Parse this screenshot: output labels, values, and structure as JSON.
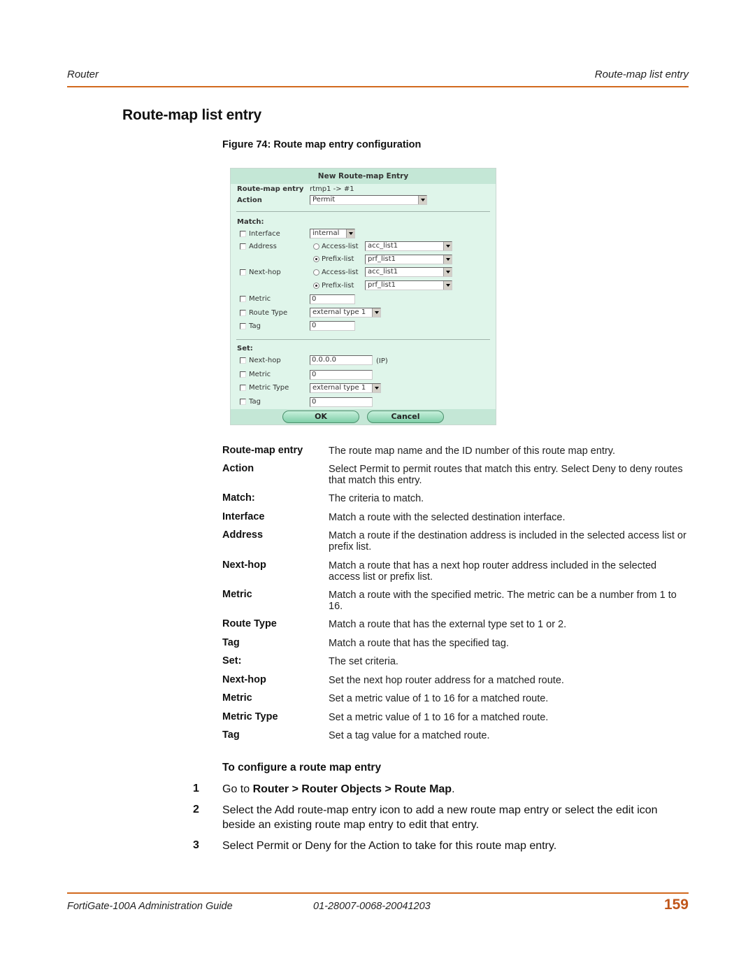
{
  "header": {
    "left": "Router",
    "right": "Route-map list entry"
  },
  "title": "Route-map list entry",
  "figure_caption": "Figure 74: Route map entry configuration",
  "form": {
    "title": "New Route-map Entry",
    "route_map_entry_label": "Route-map entry",
    "route_map_entry_value": "rtmp1 -> #1",
    "action_label": "Action",
    "action_value": "Permit",
    "match_heading": "Match:",
    "match": {
      "interface": {
        "label": "Interface",
        "value": "internal",
        "checked": false
      },
      "address": {
        "label": "Address",
        "checked": false,
        "access_list_label": "Access-list",
        "access_list_value": "acc_list1",
        "access_selected": false,
        "prefix_list_label": "Prefix-list",
        "prefix_list_value": "prf_list1",
        "prefix_selected": true
      },
      "next_hop": {
        "label": "Next-hop",
        "checked": false,
        "access_list_label": "Access-list",
        "access_list_value": "acc_list1",
        "access_selected": false,
        "prefix_list_label": "Prefix-list",
        "prefix_list_value": "prf_list1",
        "prefix_selected": true
      },
      "metric": {
        "label": "Metric",
        "value": "0",
        "checked": false
      },
      "route_type": {
        "label": "Route Type",
        "value": "external type 1",
        "checked": false
      },
      "tag": {
        "label": "Tag",
        "value": "0",
        "checked": false
      }
    },
    "set_heading": "Set:",
    "set": {
      "next_hop": {
        "label": "Next-hop",
        "value": "0.0.0.0",
        "suffix": "(IP)",
        "checked": false
      },
      "metric": {
        "label": "Metric",
        "value": "0",
        "checked": false
      },
      "metric_type": {
        "label": "Metric Type",
        "value": "external type 1",
        "checked": false
      },
      "tag": {
        "label": "Tag",
        "value": "0",
        "checked": false
      }
    },
    "ok_label": "OK",
    "cancel_label": "Cancel"
  },
  "definitions": [
    {
      "term": "Route-map entry",
      "desc": "The route map name and the ID number of this route map entry."
    },
    {
      "term": "Action",
      "desc": "Select Permit to permit routes that match this entry. Select Deny to deny routes that match this entry."
    },
    {
      "term": "Match:",
      "desc": "The criteria to match."
    },
    {
      "term": "Interface",
      "desc": "Match a route with the selected destination interface."
    },
    {
      "term": "Address",
      "desc": "Match a route if the destination address is included in the selected access list or prefix list."
    },
    {
      "term": "Next-hop",
      "desc": "Match a route that has a next hop router address included in the selected access list or prefix list."
    },
    {
      "term": "Metric",
      "desc": "Match a route with the specified metric. The metric can be a number from 1 to 16."
    },
    {
      "term": "Route Type",
      "desc": "Match a route that has the external type set to 1 or 2."
    },
    {
      "term": "Tag",
      "desc": "Match a route that has the specified tag."
    },
    {
      "term": "Set:",
      "desc": "The set criteria."
    },
    {
      "term": "Next-hop",
      "desc": "Set the next hop router address for a matched route."
    },
    {
      "term": "Metric",
      "desc": "Set a metric value of 1 to 16 for a matched route."
    },
    {
      "term": "Metric Type",
      "desc": "Set a metric value of 1 to 16 for a matched route."
    },
    {
      "term": "Tag",
      "desc": "Set a tag value for a matched route."
    }
  ],
  "procedure": {
    "title": "To configure a route map entry",
    "steps": [
      {
        "num": "1",
        "prefix": "Go to ",
        "bold": "Router > Router Objects > Route Map",
        "suffix": "."
      },
      {
        "num": "2",
        "text": "Select the Add route-map entry icon to add a new route map entry or select the edit icon beside an existing route map entry to edit that entry."
      },
      {
        "num": "3",
        "text": "Select Permit or Deny for the Action to take for this route map entry."
      }
    ]
  },
  "footer": {
    "guide": "FortiGate-100A Administration Guide",
    "doc_id": "01-28007-0068-20041203",
    "page": "159"
  }
}
